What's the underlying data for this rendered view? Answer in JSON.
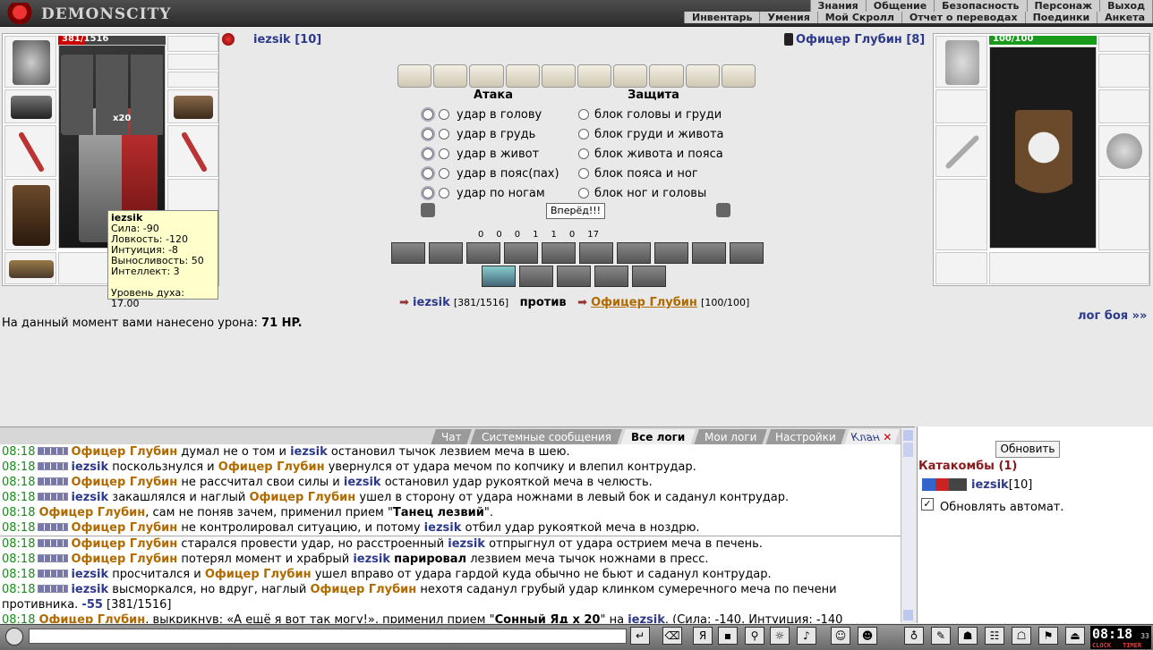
{
  "header": {
    "logo_text": "DEMONSCITY",
    "menu_top": [
      "Знания",
      "Общение",
      "Безопасность",
      "Персонаж",
      "Выход"
    ],
    "menu_bottom": [
      "Инвентарь",
      "Умения",
      "Мой Скролл",
      "Отчет о переводах",
      "Поединки",
      "Анкета"
    ]
  },
  "player": {
    "name": "iezsik [10]",
    "hp": "381/1516",
    "hp_fraction": 0.25,
    "item_count": "x20"
  },
  "enemy": {
    "name": "Офицер Глубин [8]",
    "hp": "100/100",
    "hp_fraction": 1.0
  },
  "attack": {
    "attack_header": "Атака",
    "defense_header": "Защита",
    "attacks": [
      "удар в голову",
      "удар в грудь",
      "удар в живот",
      "удар в пояс(пах)",
      "удар по ногам"
    ],
    "defenses": [
      "блок головы и груди",
      "блок груди и живота",
      "блок живота и пояса",
      "блок пояса и ног",
      "блок ног и головы"
    ],
    "forward_label": "Вперёд!!!"
  },
  "tooltip": {
    "name": "iezsik",
    "lines": [
      "Сила: -90",
      "Ловкость: -120",
      "Интуиция: -8",
      "Выносливость: 50",
      "Интеллект: 3"
    ],
    "spirit": "Уровень духа: 17.00"
  },
  "counters": [
    "0",
    "0",
    "0",
    "1",
    "1",
    "0",
    "17"
  ],
  "versus": {
    "player": "iezsik",
    "player_hp": "[381/1516]",
    "vs": "против",
    "enemy": "Офицер Глубин",
    "enemy_hp": "[100/100]"
  },
  "damage": {
    "text": "На данный момент вами нанесено урона:",
    "value": "71 HP."
  },
  "log_link": "лог боя »»",
  "chat": {
    "tabs": [
      "Чат",
      "Системные сообщения",
      "Все логи",
      "Мои логи",
      "Настройки",
      "Клан"
    ],
    "active_tab": "Все логи",
    "lines": [
      {
        "t": "08:18",
        "parts": [
          [
            "e",
            "Офицер Глубин"
          ],
          [
            "n",
            " думал не о том и "
          ],
          [
            "p",
            "iezsik"
          ],
          [
            "n",
            " остановил тычок лезвием меча в шею."
          ]
        ]
      },
      {
        "t": "08:18",
        "parts": [
          [
            "p",
            "iezsik"
          ],
          [
            "n",
            " поскользнулся и "
          ],
          [
            "e",
            "Офицер Глубин"
          ],
          [
            "n",
            " увернулся от удара мечом по копчику и влепил контрудар."
          ]
        ]
      },
      {
        "t": "08:18",
        "parts": [
          [
            "e",
            "Офицер Глубин"
          ],
          [
            "n",
            " не рассчитал свои силы и "
          ],
          [
            "p",
            "iezsik"
          ],
          [
            "n",
            " остановил удар рукояткой меча в челюсть."
          ]
        ]
      },
      {
        "t": "08:18",
        "parts": [
          [
            "p",
            "iezsik"
          ],
          [
            "n",
            " закашлялся и наглый "
          ],
          [
            "e",
            "Офицер Глубин"
          ],
          [
            "n",
            " ушел в сторону от удара ножнами в левый бок и саданул контрудар."
          ]
        ]
      },
      {
        "t": "08:18",
        "nosq": true,
        "parts": [
          [
            "e",
            "Офицер Глубин"
          ],
          [
            "n",
            ", сам не поняв зачем, применил прием \""
          ],
          [
            "b",
            "Танец лезвий"
          ],
          [
            "n",
            "\"."
          ]
        ]
      },
      {
        "t": "08:18",
        "parts": [
          [
            "e",
            "Офицер Глубин"
          ],
          [
            "n",
            " не контролировал ситуацию, и потому "
          ],
          [
            "p",
            "iezsik"
          ],
          [
            "n",
            " отбил удар рукояткой меча в ноздрю."
          ]
        ]
      },
      {
        "t": "08:18",
        "parts": [
          [
            "e",
            "Офицер Глубин"
          ],
          [
            "n",
            " старался провести удар, но расстроенный "
          ],
          [
            "p",
            "iezsik"
          ],
          [
            "n",
            " отпрыгнул от удара острием меча в печень."
          ]
        ]
      },
      {
        "t": "08:18",
        "parts": [
          [
            "e",
            "Офицер Глубин"
          ],
          [
            "n",
            " потерял момент и храбрый "
          ],
          [
            "p",
            "iezsik"
          ],
          [
            "n",
            " "
          ],
          [
            "b",
            "парировал"
          ],
          [
            "n",
            " лезвием меча тычок ножнами в пресс."
          ]
        ]
      },
      {
        "t": "08:18",
        "parts": [
          [
            "p",
            "iezsik"
          ],
          [
            "n",
            " просчитался и "
          ],
          [
            "e",
            "Офицер Глубин"
          ],
          [
            "n",
            " ушел вправо от удара гардой куда обычно не бьют и саданул контрудар."
          ]
        ]
      },
      {
        "t": "08:18",
        "parts": [
          [
            "p",
            "iezsik"
          ],
          [
            "n",
            " высморкался, но вдруг, наглый "
          ],
          [
            "e",
            "Офицер Глубин"
          ],
          [
            "n",
            " нехотя саданул грубый удар клинком сумеречного меча по печени"
          ]
        ]
      },
      {
        "t": "",
        "cont": true,
        "parts": [
          [
            "n",
            "противника. "
          ],
          [
            "d",
            "-55"
          ],
          [
            "n",
            " [381/1516]"
          ]
        ]
      },
      {
        "t": "08:18",
        "nosq": true,
        "parts": [
          [
            "e",
            "Офицер Глубин"
          ],
          [
            "n",
            ", выкрикнув: «А ещё я вот так могу!», применил прием \""
          ],
          [
            "b",
            "Сонный Яд x 20"
          ],
          [
            "n",
            "\" на "
          ],
          [
            "p",
            "iezsik"
          ],
          [
            "n",
            ". (Сила: -140, Интуиция: -140"
          ]
        ]
      }
    ]
  },
  "right": {
    "update_label": "Обновить",
    "location": "Катакомбы (1)",
    "member": "iezsik",
    "member_level": "[10]",
    "auto_update": "Обновлять автомат."
  },
  "bottom": {
    "clock": "08:18",
    "clock_sec": "33",
    "clock_label": "CLOCK",
    "timer_label": "TIMER"
  }
}
